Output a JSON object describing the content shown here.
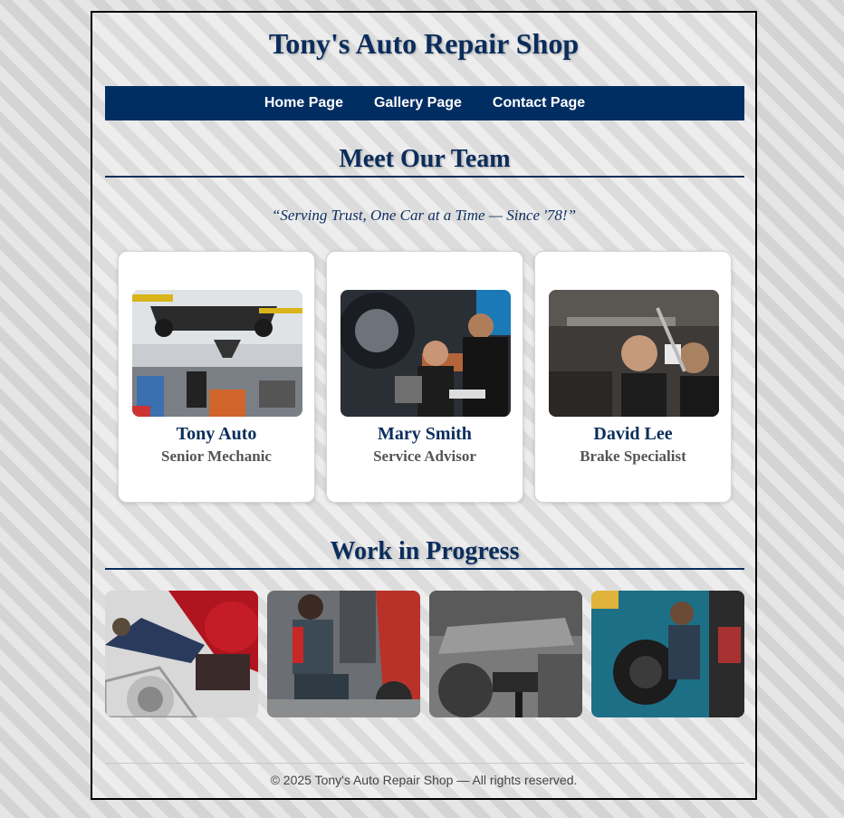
{
  "site": {
    "title": "Tony's Auto Repair Shop"
  },
  "nav": {
    "items": [
      {
        "label": "Home Page"
      },
      {
        "label": "Gallery Page"
      },
      {
        "label": "Contact Page"
      }
    ]
  },
  "team": {
    "heading": "Meet Our Team",
    "tagline": "“Serving Trust, One Car at a Time — Since '78!”",
    "members": [
      {
        "name": "Tony Auto",
        "role": "Senior Mechanic"
      },
      {
        "name": "Mary Smith",
        "role": "Service Advisor"
      },
      {
        "name": "David Lee",
        "role": "Brake Specialist"
      }
    ]
  },
  "gallery": {
    "heading": "Work in Progress"
  },
  "footer": {
    "text": "© 2025 Tony's Auto Repair Shop — All rights reserved."
  },
  "colors": {
    "brand_navy": "#0b2d5c",
    "nav_bg": "#002e63"
  }
}
